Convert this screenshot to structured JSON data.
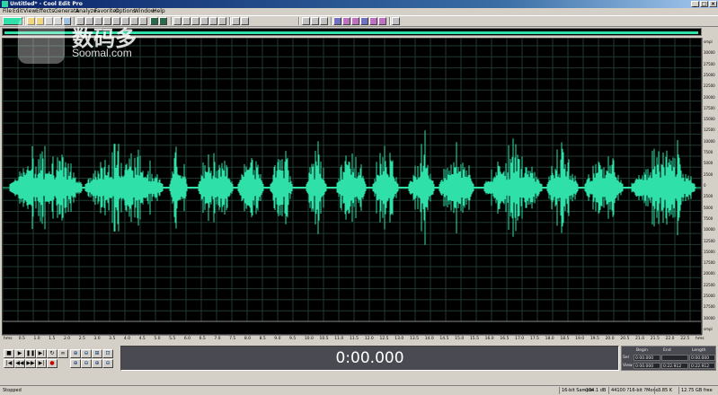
{
  "window": {
    "title": "Untitled* - Cool Edit Pro"
  },
  "menu": [
    "File",
    "Edit",
    "View",
    "Effects",
    "Generate",
    "Analyze",
    "Favorites",
    "Options",
    "Window",
    "Help"
  ],
  "time_display": "0:00.000",
  "selection_panel": {
    "headers": [
      "Begin",
      "End",
      "Length"
    ],
    "rows": [
      {
        "label": "Sel",
        "begin": "0:00.000",
        "end": "",
        "length": "0:00.000"
      },
      {
        "label": "View",
        "begin": "0:00.000",
        "end": "0:22.912",
        "length": "0:22.912"
      }
    ]
  },
  "status": {
    "state": "Stopped",
    "bit_info": "16-bit Sample",
    "level": "-104.1 dB",
    "format": "44100 ?16-bit ?Mono",
    "size": "3.85 K",
    "free": "12.75 GB free"
  },
  "watermark": {
    "cn": "数码多",
    "en": "Soomal.com"
  },
  "timeline_labels": [
    "hms",
    "0.5",
    "1.0",
    "1.5",
    "2.0",
    "2.5",
    "3.0",
    "3.5",
    "4.0",
    "4.5",
    "5.0",
    "5.5",
    "6.0",
    "6.5",
    "7.0",
    "7.5",
    "8.0",
    "8.5",
    "9.0",
    "9.5",
    "10.0",
    "10.5",
    "11.0",
    "11.5",
    "12.0",
    "12.5",
    "13.0",
    "13.5",
    "14.0",
    "14.5",
    "15.0",
    "15.5",
    "16.0",
    "16.5",
    "17.0",
    "17.5",
    "18.0",
    "18.5",
    "19.0",
    "19.5",
    "20.0",
    "20.5",
    "21.0",
    "21.5",
    "22.0",
    "22.5",
    "hms"
  ],
  "amplitude_labels": [
    "smpl",
    "30000",
    "27500",
    "25000",
    "22500",
    "20000",
    "17500",
    "15000",
    "12500",
    "10000",
    "7500",
    "5000",
    "2500",
    "0",
    "2500",
    "5000",
    "7500",
    "10000",
    "12500",
    "15000",
    "17500",
    "20000",
    "22500",
    "25000",
    "27500",
    "30000",
    "smpl"
  ],
  "colors": {
    "waveform": "#2fe0a8",
    "background": "#000000",
    "grid": "#1f3a2c",
    "display_bg": "#4a4a52"
  },
  "icons": {
    "transport": [
      "stop-icon",
      "play-icon",
      "pause-icon",
      "play-to-end-icon",
      "loop-icon",
      "record-icon"
    ],
    "transport_row2": [
      "go-start-icon",
      "rewind-icon",
      "fast-forward-icon",
      "go-end-icon",
      "record-icon"
    ],
    "zoom": [
      "zoom-in-icon",
      "zoom-out-icon",
      "zoom-full-icon",
      "zoom-selection-icon"
    ]
  }
}
